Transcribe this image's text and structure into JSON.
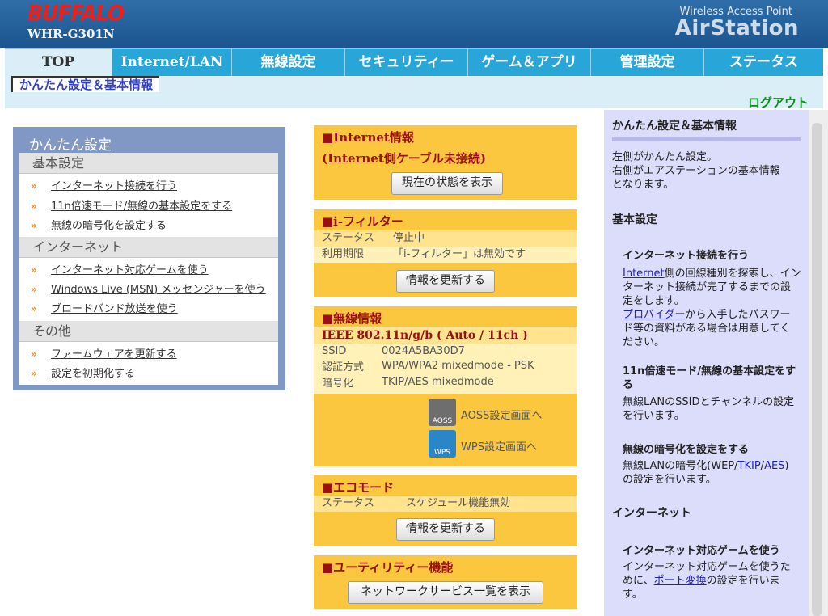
{
  "header": {
    "brand": "BUFFALO",
    "model": "WHR-G301N",
    "product_line_1": "Wireless Access Point",
    "product_line_2": "AirStation"
  },
  "nav": {
    "tabs": [
      {
        "label": "TOP",
        "active": true
      },
      {
        "label": "Internet/LAN"
      },
      {
        "label": "無線設定"
      },
      {
        "label": "セキュリティー"
      },
      {
        "label": "ゲーム＆アプリ"
      },
      {
        "label": "管理設定"
      },
      {
        "label": "ステータス"
      }
    ],
    "breadcrumb": "かんたん設定＆基本情報",
    "logout": "ログアウト"
  },
  "easy": {
    "title": "かんたん設定",
    "sections": [
      {
        "label": "基本設定",
        "items": [
          "インターネット接続を行う",
          "11n倍速モード/無線の基本設定をする",
          "無線の暗号化を設定する"
        ]
      },
      {
        "label": "インターネット",
        "items": [
          "インターネット対応ゲームを使う",
          "Windows Live (MSN) メッセンジャーを使う",
          "ブロードバンド放送を使う"
        ]
      },
      {
        "label": "その他",
        "items": [
          "ファームウェアを更新する",
          "設定を初期化する"
        ]
      }
    ]
  },
  "internet": {
    "title": "■Internet情報",
    "status": "(Internet側ケーブル未接続)",
    "button": "現在の状態を表示"
  },
  "ifilter": {
    "title": "■i-フィルター",
    "rows": [
      {
        "label": "ステータス",
        "value": "停止中"
      },
      {
        "label": "利用期限",
        "value": "「i-フィルター」は無効です"
      }
    ],
    "button": "情報を更新する"
  },
  "wireless": {
    "title": "■無線情報",
    "mode": "IEEE 802.11n/g/b ( Auto / 11ch )",
    "rows": [
      {
        "label": "SSID",
        "value": "0024A5BA30D7"
      },
      {
        "label": "認証方式",
        "value": "WPA/WPA2 mixedmode - PSK"
      },
      {
        "label": "暗号化",
        "value": "TKIP/AES mixedmode"
      }
    ],
    "aoss_link": "AOSS設定画面へ",
    "wps_link": "WPS設定画面へ",
    "aoss_icon_text": "AOSS",
    "wps_icon_text": "WPS"
  },
  "eco": {
    "title": "■エコモード",
    "row": {
      "label": "ステータス",
      "value": "スケジュール機能無効"
    },
    "button": "情報を更新する"
  },
  "utility": {
    "title": "■ユーティリティー機能",
    "button": "ネットワークサービス一覧を表示"
  },
  "side": {
    "title": "かんたん設定＆基本情報",
    "intro_1": "左側がかんたん設定。",
    "intro_2": "右側がエアステーションの基本情報",
    "intro_3": "となります。",
    "h_basic": "基本設定",
    "h_inet_conn": "インターネット接続を行う",
    "p1_link": "Internet",
    "p1_a": "側の回線種別を探索し、イン",
    "p1_b": "ターネット接続が完了するまでの設",
    "p1_c": "定をします。",
    "p1_link2": "プロバイダー",
    "p1_d": "から入手したパスワー",
    "p1_e": "ド等の資料がある場合は用意してく",
    "p1_f": "ださい。",
    "h_11n_1": "11n倍速モード/無線の基本設定をす",
    "h_11n_2": "る",
    "p2_a": "無線LANのSSIDとチャンネルの設定",
    "p2_b": "を行います。",
    "h_enc": "無線の暗号化を設定をする",
    "p3_a": "無線LANの暗号化(WEP/",
    "p3_link1": "TKIP",
    "p3_sep": "/",
    "p3_link2": "AES",
    "p3_b": ")",
    "p3_c": "の設定を行います。",
    "h_internet": "インターネット",
    "h_game": "インターネット対応ゲームを使う",
    "p4_a": "インターネット対応ゲームを使うた",
    "p4_b": "めに、",
    "p4_link": "ポート変換",
    "p4_c": "の設定を行いま",
    "p4_d": "す。"
  }
}
